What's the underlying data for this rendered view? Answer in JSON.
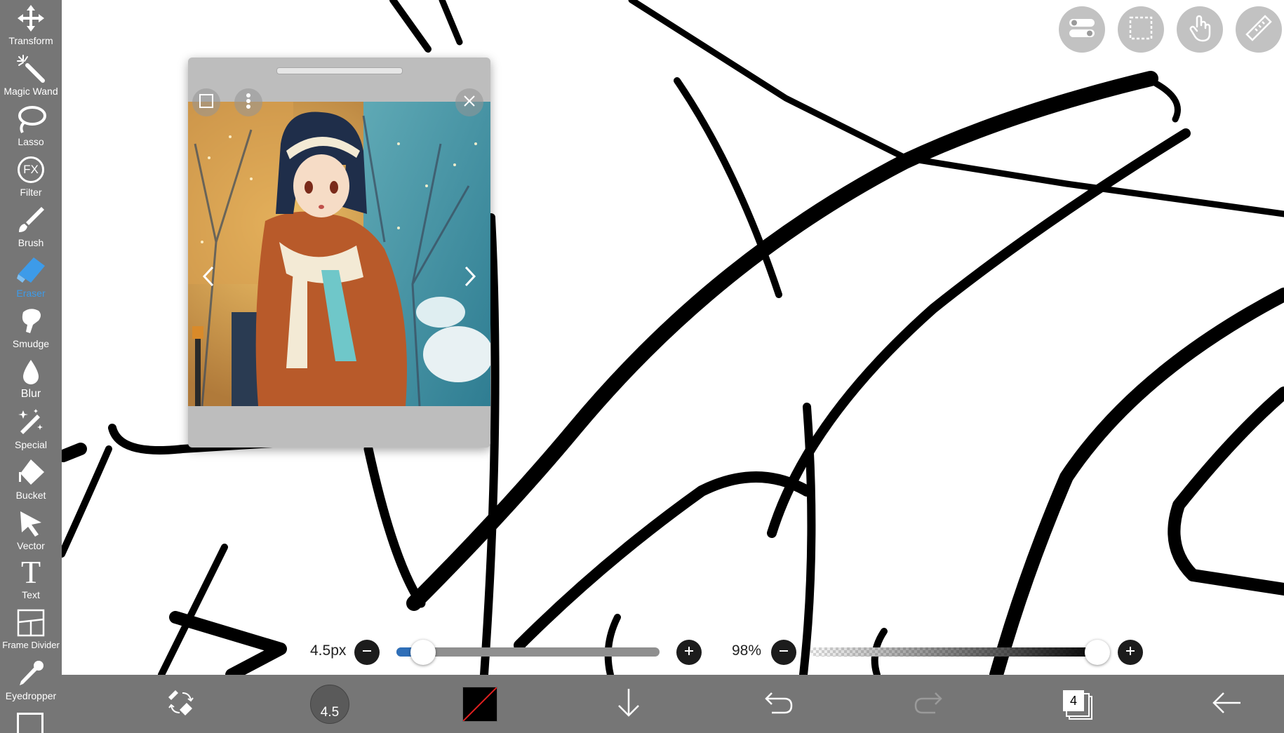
{
  "toolbar": {
    "tools": [
      {
        "label": "Transform",
        "icon": "move-icon"
      },
      {
        "label": "Magic Wand",
        "icon": "magic-wand-icon"
      },
      {
        "label": "Lasso",
        "icon": "lasso-icon"
      },
      {
        "label": "Filter",
        "icon": "fx-icon"
      },
      {
        "label": "Brush",
        "icon": "brush-icon"
      },
      {
        "label": "Eraser",
        "icon": "eraser-icon",
        "active": true
      },
      {
        "label": "Smudge",
        "icon": "smudge-icon"
      },
      {
        "label": "Blur",
        "icon": "droplet-icon"
      },
      {
        "label": "Special",
        "icon": "sparkle-wand-icon"
      },
      {
        "label": "Bucket",
        "icon": "bucket-icon"
      },
      {
        "label": "Vector",
        "icon": "cursor-arrow-icon"
      },
      {
        "label": "Text",
        "icon": "text-t-icon"
      },
      {
        "label": "Frame Divider",
        "icon": "frame-divider-icon"
      },
      {
        "label": "Eyedropper",
        "icon": "eyedropper-icon"
      }
    ],
    "filter_glyph": "FX",
    "text_glyph": "T"
  },
  "top_buttons": [
    "toggle-settings-icon",
    "selection-icon",
    "hand-gesture-icon",
    "ruler-icon"
  ],
  "sliders": {
    "size_label": "4.5px",
    "size_value": 4.5,
    "size_fraction": 0.1,
    "opacity_label": "98%",
    "opacity_fraction": 0.98
  },
  "bottom_bar": {
    "brush_size_text": "4.5",
    "layers_count": "4",
    "colors": {
      "current": "#000000",
      "accent": "#3d9be9"
    }
  }
}
